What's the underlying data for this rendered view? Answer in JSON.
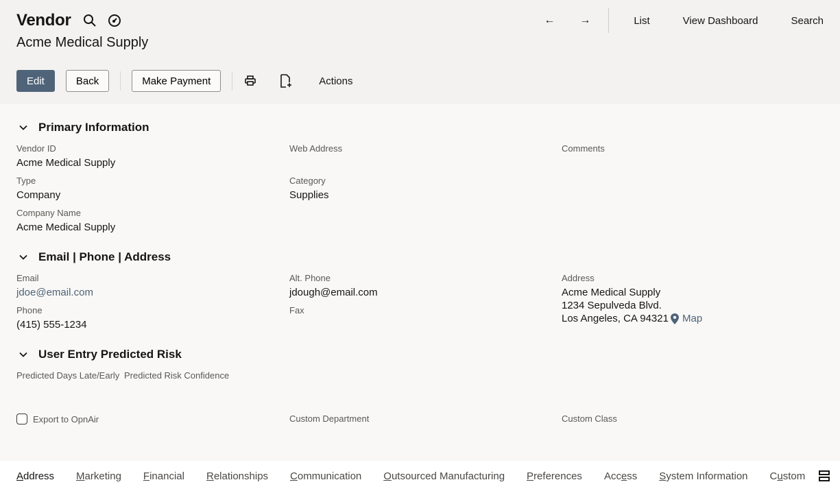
{
  "header": {
    "record_type": "Vendor",
    "record_name": "Acme Medical Supply",
    "icons": [
      "search-icon",
      "dashboard-gauge-icon"
    ]
  },
  "nav": {
    "back_arrow": "←",
    "forward_arrow": "→",
    "links": [
      "List",
      "View Dashboard",
      "Search"
    ]
  },
  "toolbar": {
    "edit_label": "Edit",
    "back_label": "Back",
    "make_payment_label": "Make Payment",
    "print_icon": "print-icon",
    "new_doc_icon": "new-document-icon",
    "actions_label": "Actions"
  },
  "colors": {
    "primary_button": "#4f6479",
    "link": "#4d6378",
    "header_bg": "#f3f2f0",
    "body_bg": "#f9f8f6"
  },
  "sections": {
    "primary": {
      "title": "Primary Information",
      "vendor_id_label": "Vendor ID",
      "vendor_id_value": "Acme Medical Supply",
      "type_label": "Type",
      "type_value": "Company",
      "company_name_label": "Company Name",
      "company_name_value": "Acme Medical Supply",
      "web_address_label": "Web Address",
      "category_label": "Category",
      "category_value": "Supplies",
      "comments_label": "Comments"
    },
    "contact": {
      "title": "Email | Phone | Address",
      "email_label": "Email",
      "email_value": "jdoe@email.com",
      "phone_label": "Phone",
      "phone_value": "(415) 555-1234",
      "alt_phone_label": "Alt. Phone",
      "alt_phone_value": "jdough@email.com",
      "fax_label": "Fax",
      "address_label": "Address",
      "address_line1": "Acme Medical Supply",
      "address_line2": "1234 Sepulveda Blvd.",
      "address_line3": "Los Angeles, CA 94321",
      "map_label": "Map"
    },
    "risk": {
      "title": "User Entry Predicted Risk",
      "days_label": "Predicted Days Late/Early",
      "confidence_label": "Predicted Risk Confidence"
    },
    "custom": {
      "export_label": "Export to OpnAir",
      "export_checked": false,
      "department_label": "Custom Department",
      "class_label": "Custom Class"
    }
  },
  "tabs": [
    {
      "pre": "",
      "key": "A",
      "post": "ddress",
      "active": true
    },
    {
      "pre": "",
      "key": "M",
      "post": "arketing",
      "active": false
    },
    {
      "pre": "",
      "key": "F",
      "post": "inancial",
      "active": false
    },
    {
      "pre": "",
      "key": "R",
      "post": "elationships",
      "active": false
    },
    {
      "pre": "",
      "key": "C",
      "post": "ommunication",
      "active": false
    },
    {
      "pre": "",
      "key": "O",
      "post": "utsourced Manufacturing",
      "active": false
    },
    {
      "pre": "",
      "key": "P",
      "post": "references",
      "active": false
    },
    {
      "pre": "Acc",
      "key": "e",
      "post": "ss",
      "active": false
    },
    {
      "pre": "",
      "key": "S",
      "post": "ystem Information",
      "active": false
    },
    {
      "pre": "C",
      "key": "u",
      "post": "stom",
      "active": false
    }
  ]
}
